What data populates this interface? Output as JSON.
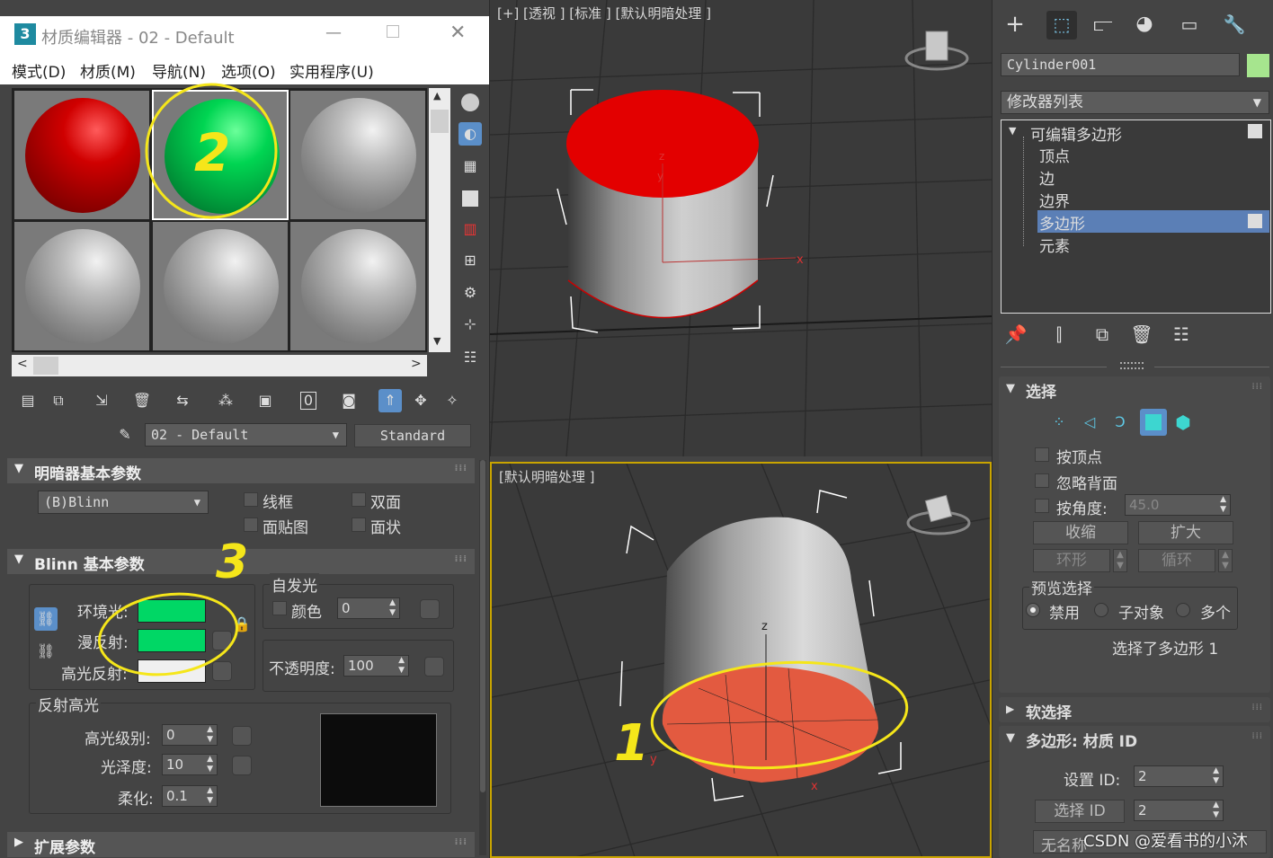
{
  "material_editor": {
    "title": "材质编辑器 - 02 - Default",
    "menu": [
      "模式(D)",
      "材质(M)",
      "导航(N)",
      "选项(O)",
      "实用程序(U)"
    ],
    "slots": [
      "red",
      "green",
      "gray",
      "gray",
      "gray",
      "gray"
    ],
    "material_name": "02 - Default",
    "material_type": "Standard",
    "shader_rollout": {
      "title": "明暗器基本参数",
      "shader": "(B)Blinn",
      "options": [
        "线框",
        "双面",
        "面贴图",
        "面状"
      ]
    },
    "blinn_rollout": {
      "title": "Blinn 基本参数",
      "ambient_label": "环境光:",
      "diffuse_label": "漫反射:",
      "specular_label": "高光反射:",
      "ambient_color": "#00d765",
      "diffuse_color": "#00d765",
      "specular_color": "#f0f0f0",
      "self_illum_title": "自发光",
      "self_illum_color_label": "颜色",
      "self_illum_value": "0",
      "opacity_label": "不透明度:",
      "opacity_value": "100",
      "specular_highlights_title": "反射高光",
      "spec_level_label": "高光级别:",
      "spec_level_value": "0",
      "glossiness_label": "光泽度:",
      "glossiness_value": "10",
      "soften_label": "柔化:",
      "soften_value": "0.1"
    },
    "extended_rollout": {
      "title": "扩展参数"
    }
  },
  "viewports": {
    "top_label": "[+] [透视 ] [标准 ] [默认明暗处理 ]",
    "bottom_label": "[默认明暗处理 ]",
    "axis_x": "x",
    "axis_y": "y",
    "axis_z": "z"
  },
  "annotations": {
    "one": "1",
    "two": "2",
    "three": "3"
  },
  "command_panel": {
    "object_name": "Cylinder001",
    "object_color": "#a6e58e",
    "modifier_list": "修改器列表",
    "stack_root": "可编辑多边形",
    "stack_items": [
      "顶点",
      "边",
      "边界",
      "多边形",
      "元素"
    ],
    "stack_selected": "多边形",
    "selection_title": "选择",
    "by_vertex": "按顶点",
    "ignore_backfacing": "忽略背面",
    "by_angle": "按角度:",
    "angle_value": "45.0",
    "shrink": "收缩",
    "grow": "扩大",
    "ring": "环形",
    "loop": "循环",
    "preview_title": "预览选择",
    "preview_options": [
      "禁用",
      "子对象",
      "多个"
    ],
    "selection_status": "选择了多边形 1",
    "soft_selection_title": "软选择",
    "poly_matid_title": "多边形: 材质 ID",
    "set_id_label": "设置 ID:",
    "set_id_value": "2",
    "select_id_button": "选择 ID",
    "select_id_value": "2",
    "bottom_text": "无名称",
    "watermark": "CSDN @爱看书的小沐"
  }
}
